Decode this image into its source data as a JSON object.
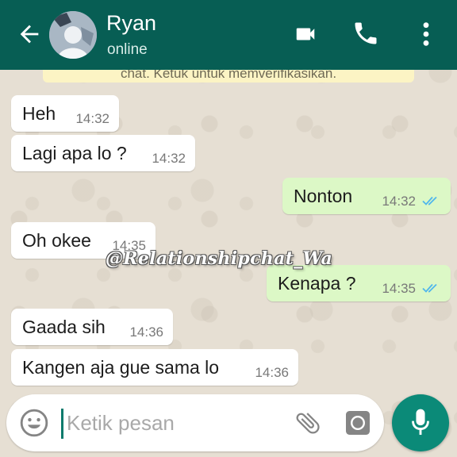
{
  "header": {
    "contact_name": "Ryan",
    "status": "online",
    "background_color": "#075e54"
  },
  "system_notice": "chat. Ketuk untuk memverifikasikan.",
  "messages": [
    {
      "direction": "in",
      "text": "Heh",
      "time": "14:32"
    },
    {
      "direction": "in",
      "text": "Lagi apa lo ?",
      "time": "14:32"
    },
    {
      "direction": "out",
      "text": "Nonton",
      "time": "14:32",
      "status": "read"
    },
    {
      "direction": "in",
      "text": "Oh okee",
      "time": "14:35"
    },
    {
      "direction": "out",
      "text": "Kenapa ?",
      "time": "14:35",
      "status": "read"
    },
    {
      "direction": "in",
      "text": "Gaada sih",
      "time": "14:36"
    },
    {
      "direction": "in",
      "text": "Kangen aja gue sama lo",
      "time": "14:36"
    }
  ],
  "watermark": "@Relationshipchat_Wa",
  "composer": {
    "placeholder": "Ketik pesan",
    "value": ""
  },
  "icons": {
    "back": "arrow-left",
    "video": "videocam",
    "call": "phone",
    "menu": "more-vertical",
    "emoji": "smiley",
    "attach": "paperclip",
    "camera": "camera",
    "mic": "microphone",
    "read_receipt": "double-check-blue"
  },
  "colors": {
    "outgoing_bubble": "#dcf8c6",
    "incoming_bubble": "#ffffff",
    "read_tick": "#4fb6ec",
    "mic_button": "#0b8a78"
  }
}
